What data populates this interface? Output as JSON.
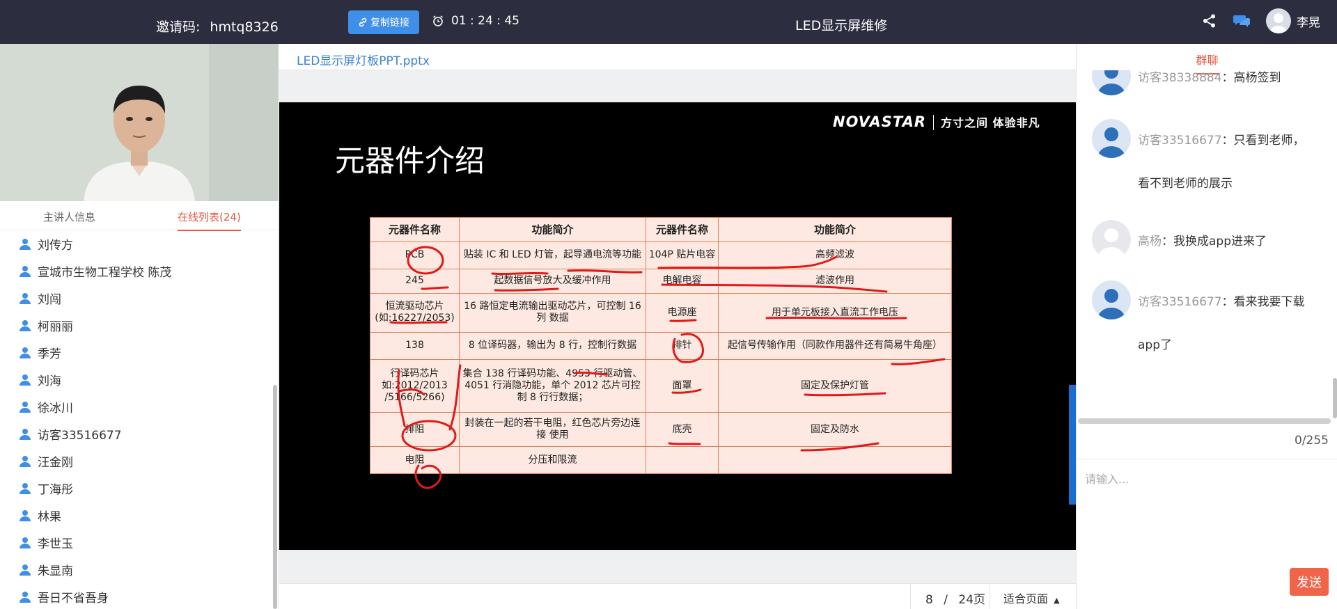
{
  "header": {
    "invite_label": "邀请码:",
    "invite_code": "hmtq8326",
    "copy_link_label": "复制链接",
    "timer": "01 : 24 : 45",
    "course_title": "LED显示屏维修",
    "user_name": "李晃"
  },
  "left_panel": {
    "tabs": {
      "presenter": "主讲人信息",
      "online": "在线列表(24)"
    },
    "online_users": [
      "刘传方",
      "宣城市生物工程学校 陈茂",
      "刘闯",
      "柯丽丽",
      "季芳",
      "刘海",
      "徐冰川",
      "访客33516677",
      "汪金刚",
      "丁海彤",
      "林果",
      "李世玉",
      "朱显南",
      "吾日不省吾身"
    ]
  },
  "document": {
    "file_name": "LED显示屏灯板PPT.pptx",
    "slide": {
      "brand": "NOVASTAR",
      "brand_slogan": "方寸之间 体验非凡",
      "title": "元器件介绍",
      "table": {
        "headers": [
          "元器件名称",
          "功能简介",
          "元器件名称",
          "功能简介"
        ],
        "rows": [
          [
            "PCB",
            "贴装 IC 和 LED 灯管，起导通电流等功能",
            "104P 贴片电容",
            "高频滤波"
          ],
          [
            "245",
            "起数据信号放大及缓冲作用",
            "电解电容",
            "滤波作用"
          ],
          [
            "恒流驱动芯片\n(如:16227/2053)",
            "16 路恒定电流输出驱动芯片，可控制 16 列 数据",
            "电源座",
            "用于单元板接入直流工作电压"
          ],
          [
            "138",
            "8 位译码器，输出为 8 行，控制行数据",
            "排针",
            "起信号传输作用（同款作用器件还有简易牛角座）"
          ],
          [
            "行译码芯片\n如:2012/2013\n/5166/5266)",
            "集合 138 行译码功能、4953 行驱动管、4051 行消隐功能，单个 2012 芯片可控制 8 行行数据；",
            "面罩",
            "固定及保护灯管"
          ],
          [
            "排阻",
            "封装在一起的若干电阻，红色芯片旁边连接 使用",
            "底壳",
            "固定及防水"
          ],
          [
            "电阻",
            "分压和限流",
            "",
            ""
          ]
        ]
      }
    },
    "pager": {
      "current": "8",
      "sep": "/",
      "total": "24页"
    },
    "fit_label": "适合页面"
  },
  "chat": {
    "tab_label": "群聊",
    "messages": [
      {
        "sender": "访客38338884",
        "text": "：高杨签到",
        "text2": "",
        "avatar": "blue"
      },
      {
        "sender": "访客33516677",
        "text": "：只看到老师，",
        "text2": "看不到老师的展示",
        "avatar": "blue"
      },
      {
        "sender": "高杨",
        "text": "：我换成app进来了",
        "text2": "",
        "avatar": "gray"
      },
      {
        "sender": "访客33516677",
        "text": "：看来我要下载",
        "text2": "app了",
        "avatar": "blue"
      }
    ],
    "counter": "0/255",
    "input_placeholder": "请输入...",
    "send_label": "发送"
  }
}
